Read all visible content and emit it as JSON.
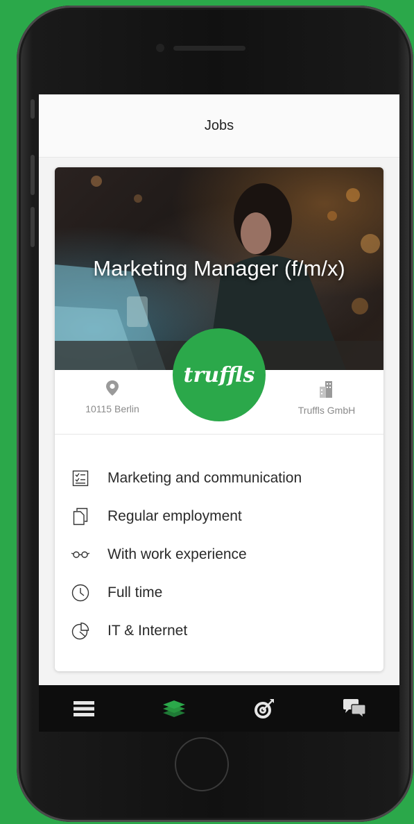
{
  "header": {
    "title": "Jobs"
  },
  "job": {
    "title": "Marketing Manager (f/m/x)",
    "company_logo_text": "truffls",
    "location": "10115 Berlin",
    "company": "Truffls GmbH"
  },
  "attributes": [
    {
      "icon": "checklist-icon",
      "label": "Marketing and communication"
    },
    {
      "icon": "document-icon",
      "label": "Regular employment"
    },
    {
      "icon": "glasses-icon",
      "label": "With work experience"
    },
    {
      "icon": "clock-icon",
      "label": "Full time"
    },
    {
      "icon": "pie-chart-icon",
      "label": "IT & Internet"
    }
  ],
  "tabbar": {
    "items": [
      {
        "name": "menu-icon"
      },
      {
        "name": "layers-icon",
        "active": true
      },
      {
        "name": "target-icon"
      },
      {
        "name": "chat-icon"
      }
    ]
  },
  "colors": {
    "brand": "#2ba84a",
    "tab_active": "#2ba84a",
    "tab_inactive": "#e6e6e6"
  }
}
